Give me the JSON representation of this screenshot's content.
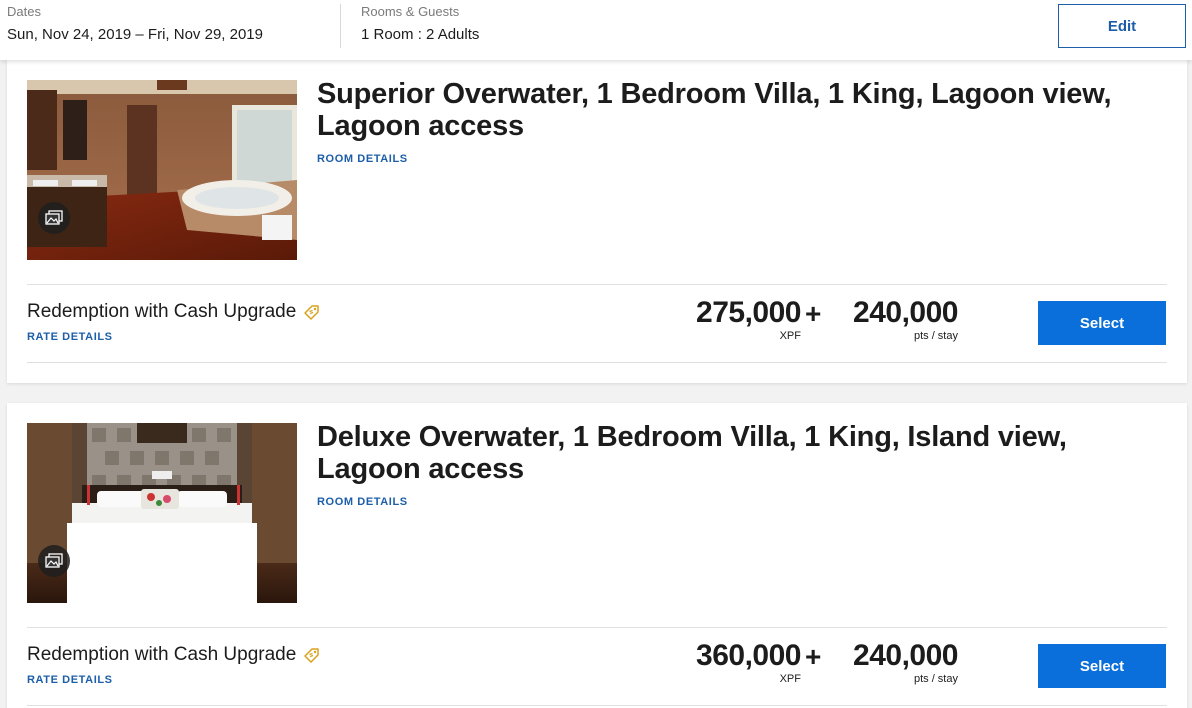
{
  "search_summary": {
    "dates_label": "Dates",
    "dates_value": "Sun, Nov 24, 2019 – Fri, Nov 29, 2019",
    "rooms_label": "Rooms & Guests",
    "rooms_value": "1 Room : 2 Adults",
    "edit_label": "Edit"
  },
  "rooms": [
    {
      "title": "Superior Overwater, 1 Bedroom Villa, 1 King, Lagoon view, Lagoon access",
      "room_details_label": "ROOM DETAILS",
      "image_icon": "gallery-icon",
      "rate": {
        "name": "Redemption with Cash Upgrade",
        "rate_details_label": "RATE DETAILS",
        "cash_amount": "275,000",
        "cash_unit": "XPF",
        "plus": "+",
        "points_amount": "240,000",
        "points_unit": "pts / stay",
        "select_label": "Select"
      }
    },
    {
      "title": "Deluxe Overwater, 1 Bedroom Villa, 1 King, Island view, Lagoon access",
      "room_details_label": "ROOM DETAILS",
      "image_icon": "gallery-icon",
      "rate": {
        "name": "Redemption with Cash Upgrade",
        "rate_details_label": "RATE DETAILS",
        "cash_amount": "360,000",
        "cash_unit": "XPF",
        "plus": "+",
        "points_amount": "240,000",
        "points_unit": "pts / stay",
        "select_label": "Select"
      }
    }
  ],
  "colors": {
    "link_blue": "#1c5ea8",
    "select_blue": "#0a6edb",
    "tag_gold": "#d9a21b"
  }
}
